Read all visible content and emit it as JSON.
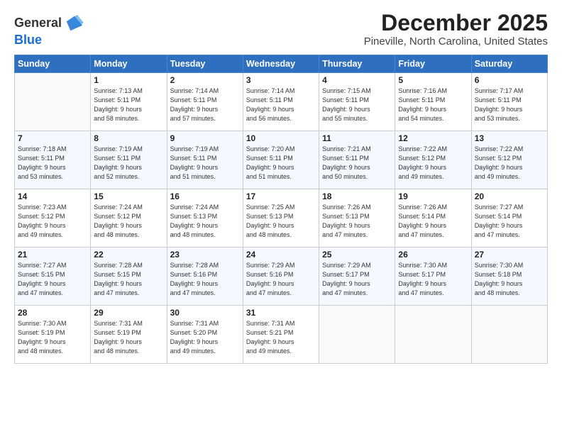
{
  "header": {
    "logo_general": "General",
    "logo_blue": "Blue",
    "month_title": "December 2025",
    "location": "Pineville, North Carolina, United States"
  },
  "days_of_week": [
    "Sunday",
    "Monday",
    "Tuesday",
    "Wednesday",
    "Thursday",
    "Friday",
    "Saturday"
  ],
  "weeks": [
    [
      {
        "day": "",
        "info": ""
      },
      {
        "day": "1",
        "info": "Sunrise: 7:13 AM\nSunset: 5:11 PM\nDaylight: 9 hours\nand 58 minutes."
      },
      {
        "day": "2",
        "info": "Sunrise: 7:14 AM\nSunset: 5:11 PM\nDaylight: 9 hours\nand 57 minutes."
      },
      {
        "day": "3",
        "info": "Sunrise: 7:14 AM\nSunset: 5:11 PM\nDaylight: 9 hours\nand 56 minutes."
      },
      {
        "day": "4",
        "info": "Sunrise: 7:15 AM\nSunset: 5:11 PM\nDaylight: 9 hours\nand 55 minutes."
      },
      {
        "day": "5",
        "info": "Sunrise: 7:16 AM\nSunset: 5:11 PM\nDaylight: 9 hours\nand 54 minutes."
      },
      {
        "day": "6",
        "info": "Sunrise: 7:17 AM\nSunset: 5:11 PM\nDaylight: 9 hours\nand 53 minutes."
      }
    ],
    [
      {
        "day": "7",
        "info": "Sunrise: 7:18 AM\nSunset: 5:11 PM\nDaylight: 9 hours\nand 53 minutes."
      },
      {
        "day": "8",
        "info": "Sunrise: 7:19 AM\nSunset: 5:11 PM\nDaylight: 9 hours\nand 52 minutes."
      },
      {
        "day": "9",
        "info": "Sunrise: 7:19 AM\nSunset: 5:11 PM\nDaylight: 9 hours\nand 51 minutes."
      },
      {
        "day": "10",
        "info": "Sunrise: 7:20 AM\nSunset: 5:11 PM\nDaylight: 9 hours\nand 51 minutes."
      },
      {
        "day": "11",
        "info": "Sunrise: 7:21 AM\nSunset: 5:11 PM\nDaylight: 9 hours\nand 50 minutes."
      },
      {
        "day": "12",
        "info": "Sunrise: 7:22 AM\nSunset: 5:12 PM\nDaylight: 9 hours\nand 49 minutes."
      },
      {
        "day": "13",
        "info": "Sunrise: 7:22 AM\nSunset: 5:12 PM\nDaylight: 9 hours\nand 49 minutes."
      }
    ],
    [
      {
        "day": "14",
        "info": "Sunrise: 7:23 AM\nSunset: 5:12 PM\nDaylight: 9 hours\nand 49 minutes."
      },
      {
        "day": "15",
        "info": "Sunrise: 7:24 AM\nSunset: 5:12 PM\nDaylight: 9 hours\nand 48 minutes."
      },
      {
        "day": "16",
        "info": "Sunrise: 7:24 AM\nSunset: 5:13 PM\nDaylight: 9 hours\nand 48 minutes."
      },
      {
        "day": "17",
        "info": "Sunrise: 7:25 AM\nSunset: 5:13 PM\nDaylight: 9 hours\nand 48 minutes."
      },
      {
        "day": "18",
        "info": "Sunrise: 7:26 AM\nSunset: 5:13 PM\nDaylight: 9 hours\nand 47 minutes."
      },
      {
        "day": "19",
        "info": "Sunrise: 7:26 AM\nSunset: 5:14 PM\nDaylight: 9 hours\nand 47 minutes."
      },
      {
        "day": "20",
        "info": "Sunrise: 7:27 AM\nSunset: 5:14 PM\nDaylight: 9 hours\nand 47 minutes."
      }
    ],
    [
      {
        "day": "21",
        "info": "Sunrise: 7:27 AM\nSunset: 5:15 PM\nDaylight: 9 hours\nand 47 minutes."
      },
      {
        "day": "22",
        "info": "Sunrise: 7:28 AM\nSunset: 5:15 PM\nDaylight: 9 hours\nand 47 minutes."
      },
      {
        "day": "23",
        "info": "Sunrise: 7:28 AM\nSunset: 5:16 PM\nDaylight: 9 hours\nand 47 minutes."
      },
      {
        "day": "24",
        "info": "Sunrise: 7:29 AM\nSunset: 5:16 PM\nDaylight: 9 hours\nand 47 minutes."
      },
      {
        "day": "25",
        "info": "Sunrise: 7:29 AM\nSunset: 5:17 PM\nDaylight: 9 hours\nand 47 minutes."
      },
      {
        "day": "26",
        "info": "Sunrise: 7:30 AM\nSunset: 5:17 PM\nDaylight: 9 hours\nand 47 minutes."
      },
      {
        "day": "27",
        "info": "Sunrise: 7:30 AM\nSunset: 5:18 PM\nDaylight: 9 hours\nand 48 minutes."
      }
    ],
    [
      {
        "day": "28",
        "info": "Sunrise: 7:30 AM\nSunset: 5:19 PM\nDaylight: 9 hours\nand 48 minutes."
      },
      {
        "day": "29",
        "info": "Sunrise: 7:31 AM\nSunset: 5:19 PM\nDaylight: 9 hours\nand 48 minutes."
      },
      {
        "day": "30",
        "info": "Sunrise: 7:31 AM\nSunset: 5:20 PM\nDaylight: 9 hours\nand 49 minutes."
      },
      {
        "day": "31",
        "info": "Sunrise: 7:31 AM\nSunset: 5:21 PM\nDaylight: 9 hours\nand 49 minutes."
      },
      {
        "day": "",
        "info": ""
      },
      {
        "day": "",
        "info": ""
      },
      {
        "day": "",
        "info": ""
      }
    ]
  ]
}
